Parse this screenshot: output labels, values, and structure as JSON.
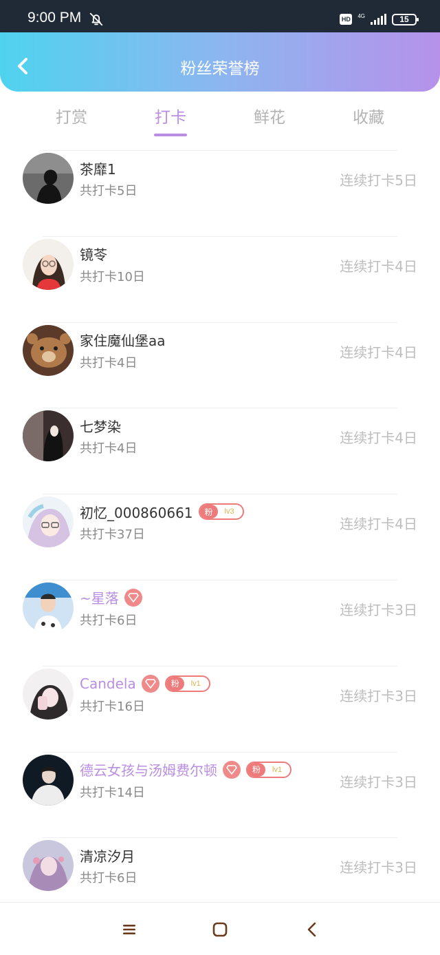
{
  "status_bar": {
    "time": "9:00 PM",
    "hd": "HD",
    "network": "4G",
    "battery": "15"
  },
  "header": {
    "title": "粉丝荣誉榜"
  },
  "tabs": [
    {
      "label": "打赏",
      "active": false
    },
    {
      "label": "打卡",
      "active": true
    },
    {
      "label": "鲜花",
      "active": false
    },
    {
      "label": "收藏",
      "active": false
    }
  ],
  "list": [
    {
      "name": "茶靡1",
      "total": "共打卡5日",
      "streak": "连续打卡5日"
    },
    {
      "name": "镜苓",
      "total": "共打卡10日",
      "streak": "连续打卡4日"
    },
    {
      "name": "家住魔仙堡aa",
      "total": "共打卡4日",
      "streak": "连续打卡4日"
    },
    {
      "name": "七梦染",
      "total": "共打卡4日",
      "streak": "连续打卡4日"
    },
    {
      "name": "初忆_000860661",
      "total": "共打卡37日",
      "streak": "连续打卡4日",
      "fan_badge": {
        "label": "粉",
        "level": "lv3"
      }
    },
    {
      "name": "~星落",
      "total": "共打卡6日",
      "streak": "连续打卡3日",
      "vip": true
    },
    {
      "name": "Candela",
      "total": "共打卡16日",
      "streak": "连续打卡3日",
      "vip": true,
      "fan_badge": {
        "label": "粉",
        "level": "lv1"
      }
    },
    {
      "name": "德云女孩与汤姆费尔顿",
      "total": "共打卡14日",
      "streak": "连续打卡3日",
      "vip": true,
      "fan_badge": {
        "label": "粉",
        "level": "lv1"
      }
    },
    {
      "name": "清凉汐月",
      "total": "共打卡6日",
      "streak": "连续打卡3日"
    }
  ],
  "colors": {
    "accent": "#b98ee3",
    "header_start": "#4fd3ef",
    "header_end": "#b692ea",
    "badge": "#ee7b7b"
  },
  "icons": [
    "back-arrow-icon",
    "bell-off-icon",
    "diamond-icon",
    "menu-icon",
    "home-square-icon",
    "nav-back-icon"
  ]
}
